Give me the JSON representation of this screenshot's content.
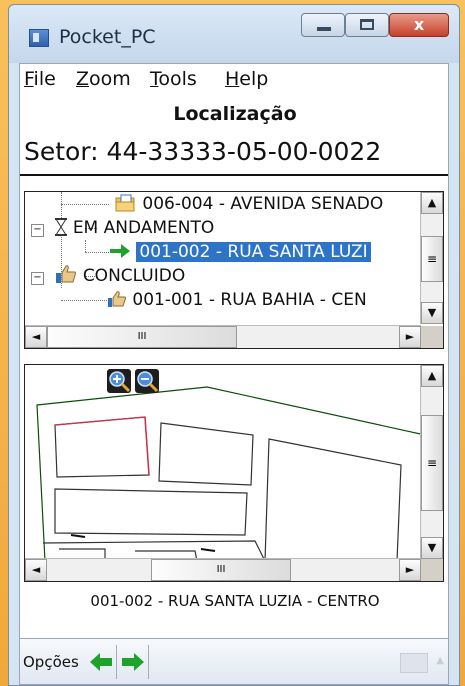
{
  "window": {
    "title": "Pocket_PC",
    "close_glyph": "x"
  },
  "menu": {
    "items": [
      {
        "label": "File",
        "accel": "F"
      },
      {
        "label": "Zoom",
        "accel": "Z"
      },
      {
        "label": "Tools",
        "accel": "T"
      },
      {
        "label": "Help",
        "accel": "H"
      }
    ]
  },
  "header": {
    "title": "Localização",
    "setor": "Setor: 44-33333-05-00-0022"
  },
  "tree": {
    "rows": [
      {
        "label": "006-004 - AVENIDA SENADO",
        "icon": "folder-icon"
      },
      {
        "label": "EM ANDAMENTO",
        "icon": "hourglass-icon",
        "expander": "−"
      },
      {
        "label": "001-002 - RUA SANTA LUZI",
        "icon": "green-arrow-icon",
        "selected": true
      },
      {
        "label": "CONCLUIDO",
        "icon": "thumbs-up-icon",
        "expander": "−"
      },
      {
        "label": "001-001 - RUA  BAHIA - CEN",
        "icon": "thumbs-up-icon"
      }
    ]
  },
  "scroll": {
    "up": "▲",
    "down": "▼",
    "left": "◄",
    "right": "►",
    "grip": "≡",
    "hgrip": "III"
  },
  "map": {
    "zoom_in_icon": "zoom-in-icon",
    "zoom_out_icon": "zoom-out-icon"
  },
  "caption": "001-002 - RUA SANTA LUZIA - CENTRO",
  "bottom": {
    "options_label": "Opções",
    "back_icon": "green-left-arrow-icon",
    "forward_icon": "green-right-arrow-icon",
    "keyboard_icon": "keyboard-icon"
  },
  "colors": {
    "selection": "#2d73c8",
    "desktop": "#f2ae36",
    "arrow": "#1ea22a"
  }
}
